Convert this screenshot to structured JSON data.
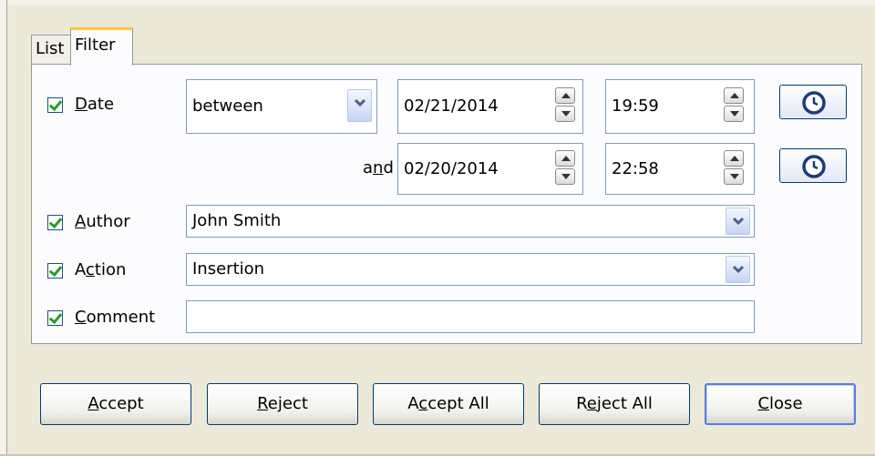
{
  "tabs": [
    {
      "label": "List",
      "selected": false
    },
    {
      "label": "Filter",
      "selected": true
    }
  ],
  "filters": {
    "date": {
      "checked": true,
      "label_prefix": "",
      "label_underline": "D",
      "label_rest": "ate",
      "condition": "between",
      "from_date": "02/21/2014",
      "from_time": "19:59",
      "and_label_pre": "a",
      "and_label_underline": "n",
      "and_label_post": "d",
      "to_date": "02/20/2014",
      "to_time": "22:58"
    },
    "author": {
      "checked": true,
      "label_underline": "A",
      "label_rest": "uthor",
      "value": "John Smith"
    },
    "action": {
      "checked": true,
      "label_pre": "A",
      "label_underline": "c",
      "label_rest": "tion",
      "value": "Insertion"
    },
    "comment": {
      "checked": true,
      "label_underline": "C",
      "label_rest": "omment",
      "value": ""
    }
  },
  "buttons": {
    "accept": {
      "u": "A",
      "rest": "ccept"
    },
    "reject": {
      "u": "R",
      "rest": "eject"
    },
    "accept_all": {
      "pre": "A",
      "u": "c",
      "rest": "cept All"
    },
    "reject_all": {
      "pre": "R",
      "u": "e",
      "rest": "ject All"
    },
    "close": {
      "u": "C",
      "rest": "lose"
    }
  },
  "icons": {
    "clock": "clock-icon",
    "dropdown": "chevron-down-icon",
    "spin_up": "arrow-up-icon",
    "spin_down": "arrow-down-icon"
  },
  "colors": {
    "check": "#21a121",
    "button_border": "#003c74",
    "tab_highlight": "#ffc83c"
  }
}
